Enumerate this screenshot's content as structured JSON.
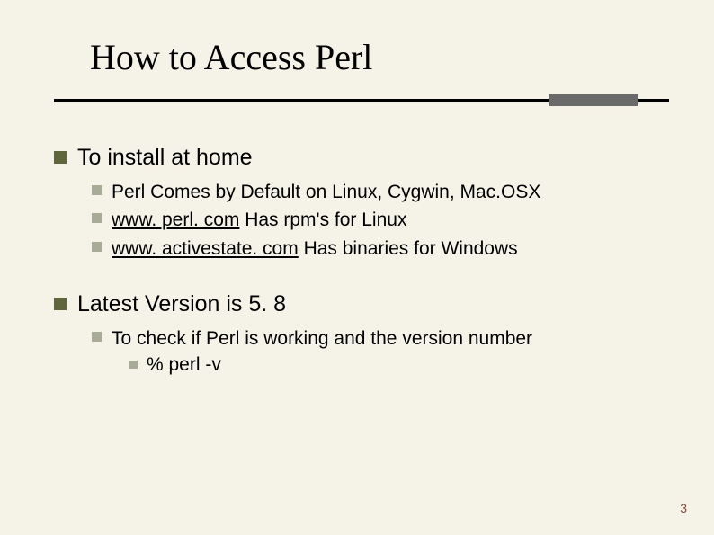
{
  "title": "How to Access Perl",
  "sections": [
    {
      "heading": "To install at home",
      "bullets": [
        {
          "pre": "Perl Comes by Default on Linux, Cygwin, Mac.OSX",
          "link": null,
          "post": null
        },
        {
          "pre": "",
          "link": "www. perl. com",
          "post": " Has rpm's for Linux"
        },
        {
          "pre": "",
          "link": "www. activestate. com",
          "post": " Has binaries for Windows"
        }
      ]
    },
    {
      "heading": "Latest Version is 5. 8",
      "bullets": [
        {
          "pre": "To check if Perl is working and the version number",
          "link": null,
          "post": null,
          "sub": [
            {
              "text": "% perl -v"
            }
          ]
        }
      ]
    }
  ],
  "page_number": "3"
}
